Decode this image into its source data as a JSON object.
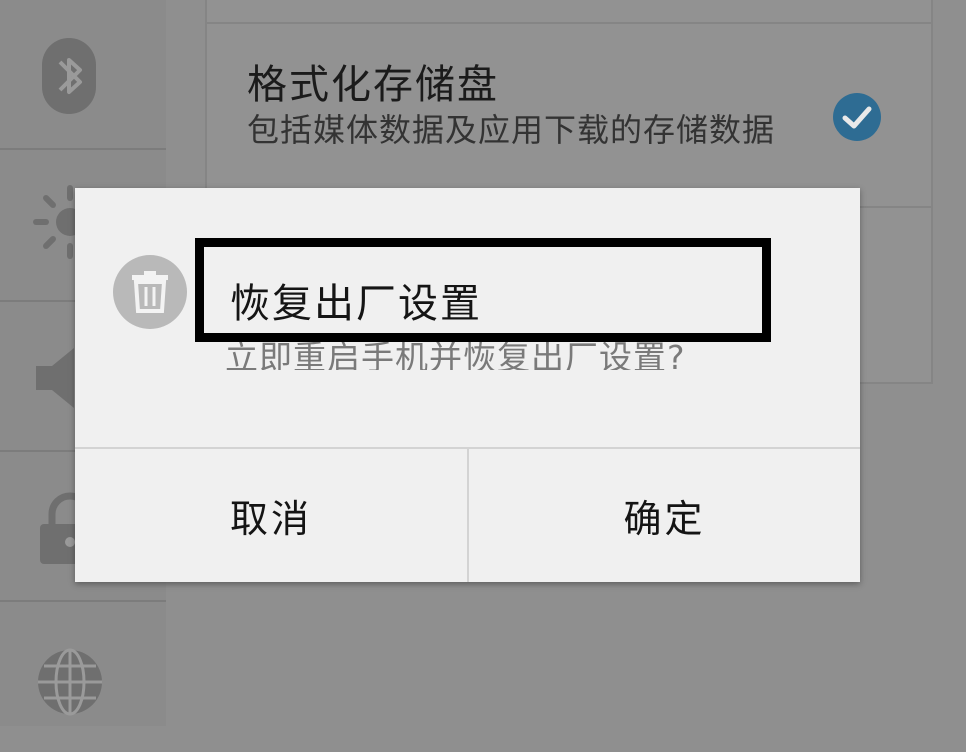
{
  "background": {
    "setting": {
      "title": "格式化存储盘",
      "description": "包括媒体数据及应用下载的存储数据",
      "checked": true
    },
    "sidebar": {
      "icons": [
        "bluetooth-icon",
        "brightness-icon",
        "volume-icon",
        "lock-icon",
        "globe-icon"
      ]
    }
  },
  "dialog": {
    "icon": "trash-icon",
    "title": "恢复出厂设置",
    "message": "立即重启手机并恢复出厂设置?",
    "buttons": {
      "cancel": "取消",
      "confirm": "确定"
    }
  },
  "colors": {
    "check_blue": "#2e6c93",
    "dialog_bg": "#f0f0f0",
    "dim_bg": "#8f8f8f"
  }
}
